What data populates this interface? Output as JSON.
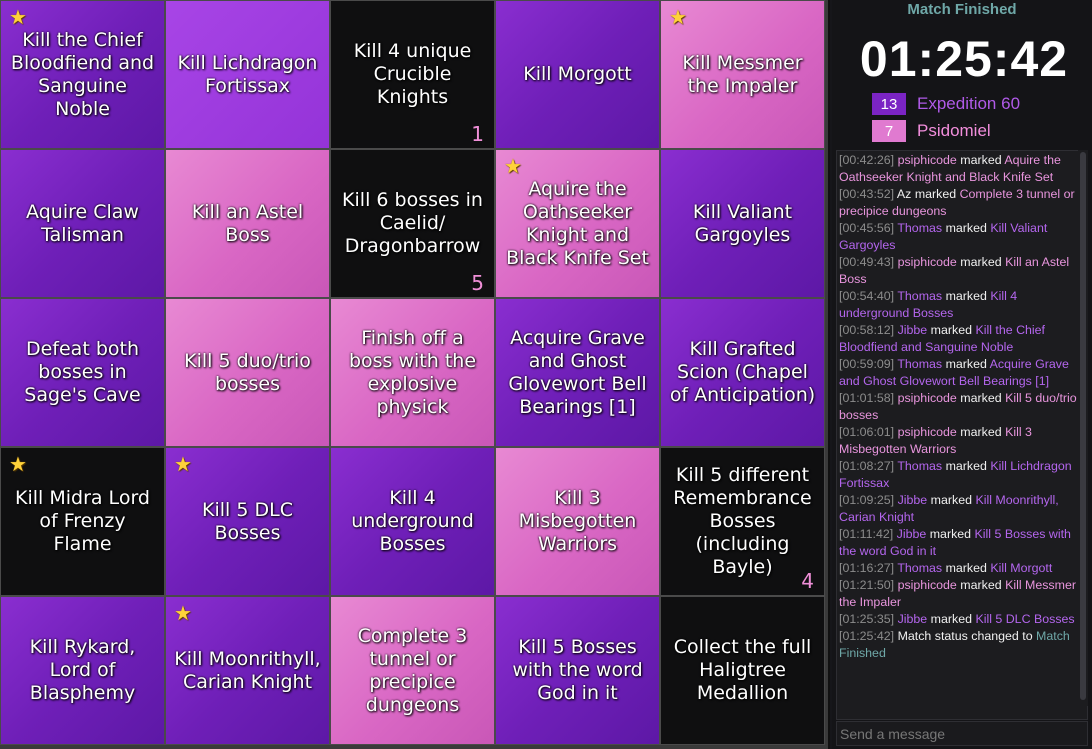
{
  "board": {
    "cells": [
      {
        "text": "Kill the Chief Bloodfiend and Sanguine Noble",
        "color": "purple",
        "star": true,
        "count": ""
      },
      {
        "text": "Kill Lichdragon Fortissax",
        "color": "violet",
        "star": false,
        "count": ""
      },
      {
        "text": "Kill 4 unique Crucible Knights",
        "color": "black",
        "star": false,
        "count": "1"
      },
      {
        "text": "Kill Morgott",
        "color": "purple",
        "star": false,
        "count": ""
      },
      {
        "text": "Kill Messmer the Impaler",
        "color": "pink",
        "star": true,
        "count": ""
      },
      {
        "text": "Aquire Claw Talisman",
        "color": "purple",
        "star": false,
        "count": ""
      },
      {
        "text": "Kill an Astel Boss",
        "color": "pink",
        "star": false,
        "count": ""
      },
      {
        "text": "Kill 6 bosses in Caelid/ Dragonbarrow",
        "color": "black",
        "star": false,
        "count": "5"
      },
      {
        "text": "Aquire the Oathseeker Knight and Black Knife Set",
        "color": "pink",
        "star": true,
        "count": ""
      },
      {
        "text": "Kill Valiant Gargoyles",
        "color": "purple",
        "star": false,
        "count": ""
      },
      {
        "text": "Defeat both bosses in Sage's Cave",
        "color": "purple",
        "star": false,
        "count": ""
      },
      {
        "text": "Kill 5 duo/trio bosses",
        "color": "pink",
        "star": false,
        "count": ""
      },
      {
        "text": "Finish off a boss with the explosive physick",
        "color": "pink",
        "star": false,
        "count": ""
      },
      {
        "text": "Acquire Grave and Ghost Glovewort Bell Bearings [1]",
        "color": "purple",
        "star": false,
        "count": ""
      },
      {
        "text": "Kill Grafted Scion (Chapel of Anticipation)",
        "color": "purple",
        "star": false,
        "count": ""
      },
      {
        "text": "Kill Midra Lord of Frenzy Flame",
        "color": "black",
        "star": true,
        "count": ""
      },
      {
        "text": "Kill 5 DLC Bosses",
        "color": "purple",
        "star": true,
        "count": ""
      },
      {
        "text": "Kill 4 underground Bosses",
        "color": "purple",
        "star": false,
        "count": ""
      },
      {
        "text": "Kill 3 Misbegotten Warriors",
        "color": "pink",
        "star": false,
        "count": ""
      },
      {
        "text": "Kill 5 different Remembrance Bosses (including Bayle)",
        "color": "black",
        "star": false,
        "count": "4"
      },
      {
        "text": "Kill Rykard, Lord of Blasphemy",
        "color": "purple",
        "star": false,
        "count": ""
      },
      {
        "text": "Kill Moonrithyll, Carian Knight",
        "color": "purple",
        "star": true,
        "count": ""
      },
      {
        "text": "Complete 3 tunnel or precipice dungeons",
        "color": "pink",
        "star": false,
        "count": ""
      },
      {
        "text": "Kill 5 Bosses with the word God in it",
        "color": "purple",
        "star": false,
        "count": ""
      },
      {
        "text": "Collect the full Haligtree Medallion",
        "color": "black",
        "star": false,
        "count": ""
      }
    ]
  },
  "sidebar": {
    "status": "Match Finished",
    "timer": "01:25:42",
    "teams": [
      {
        "score": "13",
        "name": "Expedition 60",
        "color": "#7b24c4"
      },
      {
        "score": "7",
        "name": "Psidomiel",
        "color": "#e07ad0"
      }
    ],
    "log": [
      {
        "ts": "[00:42:26]",
        "player": "psiphicode",
        "pclass": "pp",
        "action": "marked",
        "goal": "Aquire the Oathseeker Knight and Black Knife Set",
        "gclass": "pink"
      },
      {
        "ts": "[00:43:52]",
        "player": "Az",
        "pclass": "plain",
        "action": "marked",
        "goal": "Complete 3 tunnel or precipice dungeons",
        "gclass": "pink"
      },
      {
        "ts": "[00:45:56]",
        "player": "Thomas",
        "pclass": "th",
        "action": "marked",
        "goal": "Kill Valiant Gargoyles",
        "gclass": "purple"
      },
      {
        "ts": "[00:49:43]",
        "player": "psiphicode",
        "pclass": "pp",
        "action": "marked",
        "goal": "Kill an Astel Boss",
        "gclass": "pink"
      },
      {
        "ts": "[00:54:40]",
        "player": "Thomas",
        "pclass": "th",
        "action": "marked",
        "goal": "Kill 4 underground Bosses",
        "gclass": "purple"
      },
      {
        "ts": "[00:58:12]",
        "player": "Jibbe",
        "pclass": "ji",
        "action": "marked",
        "goal": "Kill the Chief Bloodfiend and Sanguine Noble",
        "gclass": "purple"
      },
      {
        "ts": "[00:59:09]",
        "player": "Thomas",
        "pclass": "th",
        "action": "marked",
        "goal": "Acquire Grave and Ghost Glovewort Bell Bearings [1]",
        "gclass": "purple"
      },
      {
        "ts": "[01:01:58]",
        "player": "psiphicode",
        "pclass": "pp",
        "action": "marked",
        "goal": "Kill 5 duo/trio bosses",
        "gclass": "pink"
      },
      {
        "ts": "[01:06:01]",
        "player": "psiphicode",
        "pclass": "pp",
        "action": "marked",
        "goal": "Kill 3 Misbegotten Warriors",
        "gclass": "pink"
      },
      {
        "ts": "[01:08:27]",
        "player": "Thomas",
        "pclass": "th",
        "action": "marked",
        "goal": "Kill Lichdragon Fortissax",
        "gclass": "purple"
      },
      {
        "ts": "[01:09:25]",
        "player": "Jibbe",
        "pclass": "ji",
        "action": "marked",
        "goal": "Kill Moonrithyll, Carian Knight",
        "gclass": "purple"
      },
      {
        "ts": "[01:11:42]",
        "player": "Jibbe",
        "pclass": "ji",
        "action": "marked",
        "goal": "Kill 5 Bosses with the word God in it",
        "gclass": "purple"
      },
      {
        "ts": "[01:16:27]",
        "player": "Thomas",
        "pclass": "th",
        "action": "marked",
        "goal": "Kill Morgott",
        "gclass": "purple"
      },
      {
        "ts": "[01:21:50]",
        "player": "psiphicode",
        "pclass": "pp",
        "action": "marked",
        "goal": "Kill Messmer the Impaler",
        "gclass": "pink"
      },
      {
        "ts": "[01:25:35]",
        "player": "Jibbe",
        "pclass": "ji",
        "action": "marked",
        "goal": "Kill 5 DLC Bosses",
        "gclass": "purple"
      },
      {
        "ts": "[01:25:42]",
        "player": "",
        "pclass": "plain",
        "action": "Match status changed to",
        "goal": "Match Finished",
        "gclass": "teal"
      }
    ],
    "message_placeholder": "Send a message"
  }
}
